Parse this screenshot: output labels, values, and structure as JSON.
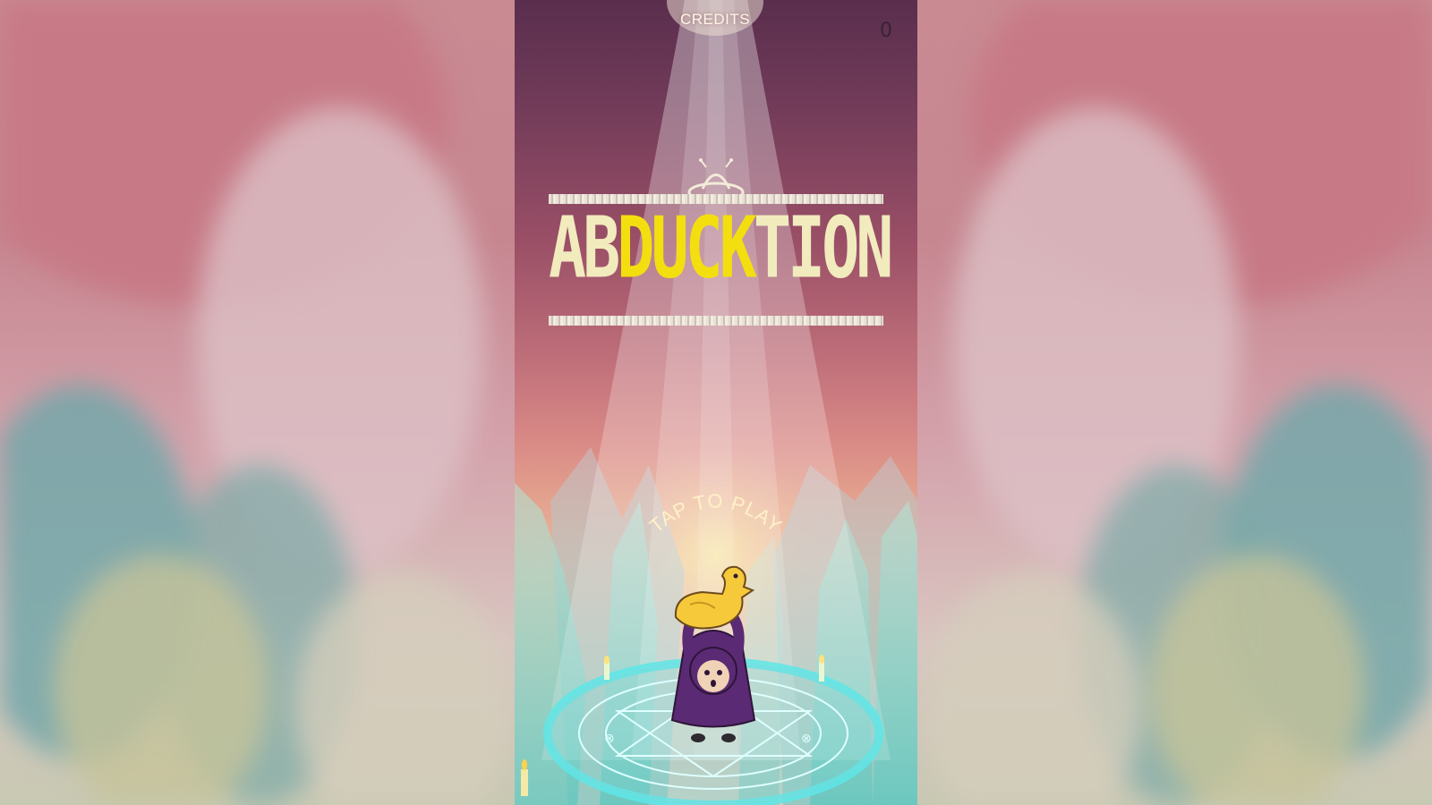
{
  "game": {
    "title_prefix": "AB",
    "title_highlight": "DUCK",
    "title_suffix": "TION",
    "credits_label": "CREDITS",
    "score": "0",
    "tap_to_play": "TAP TO PLAY"
  },
  "colors": {
    "title_light": "#f1ebbe",
    "title_highlight": "#f3df10",
    "portal_cyan": "#5ee6e8",
    "duck_yellow": "#f5c93a",
    "robe_purple": "#5b2a74"
  },
  "icons": {
    "ufo": "ufo-icon",
    "duck": "duck-icon",
    "candle": "candle-icon"
  }
}
